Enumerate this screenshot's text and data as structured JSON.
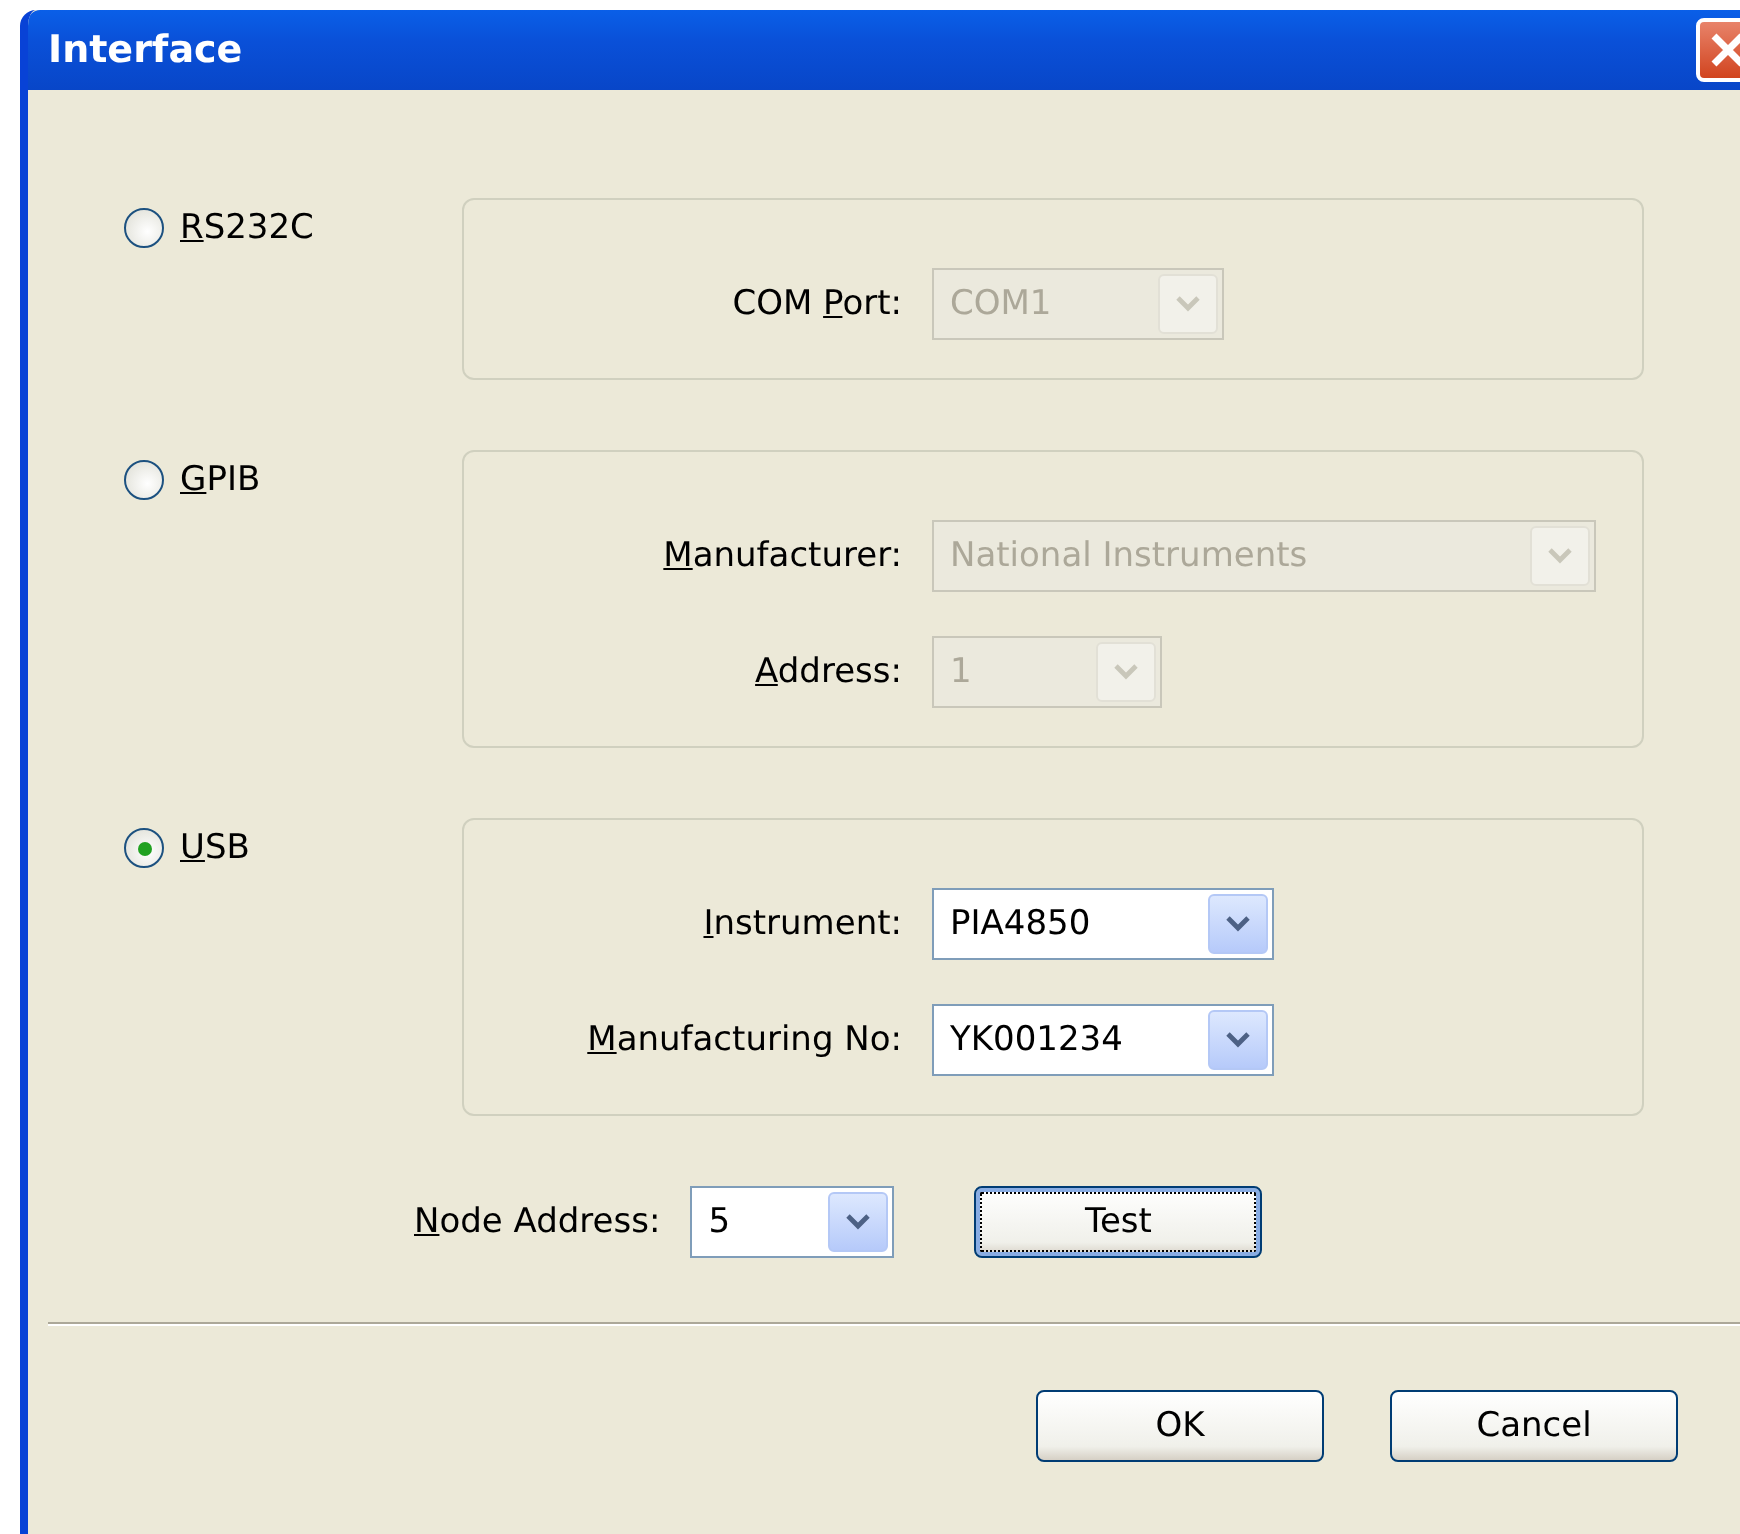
{
  "window": {
    "title": "Interface"
  },
  "interfaces": [
    {
      "label": [
        {
          "text": "R",
          "underlined": true
        },
        {
          "text": "S232C",
          "underlined": false
        }
      ],
      "selected": false,
      "fields": [
        {
          "label": [
            {
              "text": "COM ",
              "underlined": false
            },
            {
              "text": "P",
              "underlined": true
            },
            {
              "text": "ort:",
              "underlined": false
            }
          ],
          "value": "COM1",
          "disabled": true
        }
      ]
    },
    {
      "label": [
        {
          "text": "G",
          "underlined": true
        },
        {
          "text": "PIB",
          "underlined": false
        }
      ],
      "selected": false,
      "fields": [
        {
          "label": [
            {
              "text": "M",
              "underlined": true
            },
            {
              "text": "anufacturer:",
              "underlined": false
            }
          ],
          "value": "National Instruments",
          "disabled": true
        },
        {
          "label": [
            {
              "text": "A",
              "underlined": true
            },
            {
              "text": "ddress:",
              "underlined": false
            }
          ],
          "value": "1",
          "disabled": true
        }
      ]
    },
    {
      "label": [
        {
          "text": "U",
          "underlined": true
        },
        {
          "text": "SB",
          "underlined": false
        }
      ],
      "selected": true,
      "fields": [
        {
          "label": [
            {
              "text": "I",
              "underlined": true
            },
            {
              "text": "nstrument:",
              "underlined": false
            }
          ],
          "value": "PIA4850",
          "disabled": false
        },
        {
          "label": [
            {
              "text": "M",
              "underlined": true
            },
            {
              "text": "anufacturing No:",
              "underlined": false
            }
          ],
          "value": "YK001234",
          "disabled": false
        }
      ]
    }
  ],
  "node_address": {
    "label": [
      {
        "text": "N",
        "underlined": true
      },
      {
        "text": "ode Address:",
        "underlined": false
      }
    ],
    "value": "5",
    "disabled": false
  },
  "test_button": {
    "label": "Test",
    "focused": true
  },
  "buttons": [
    "OK",
    "Cancel"
  ]
}
